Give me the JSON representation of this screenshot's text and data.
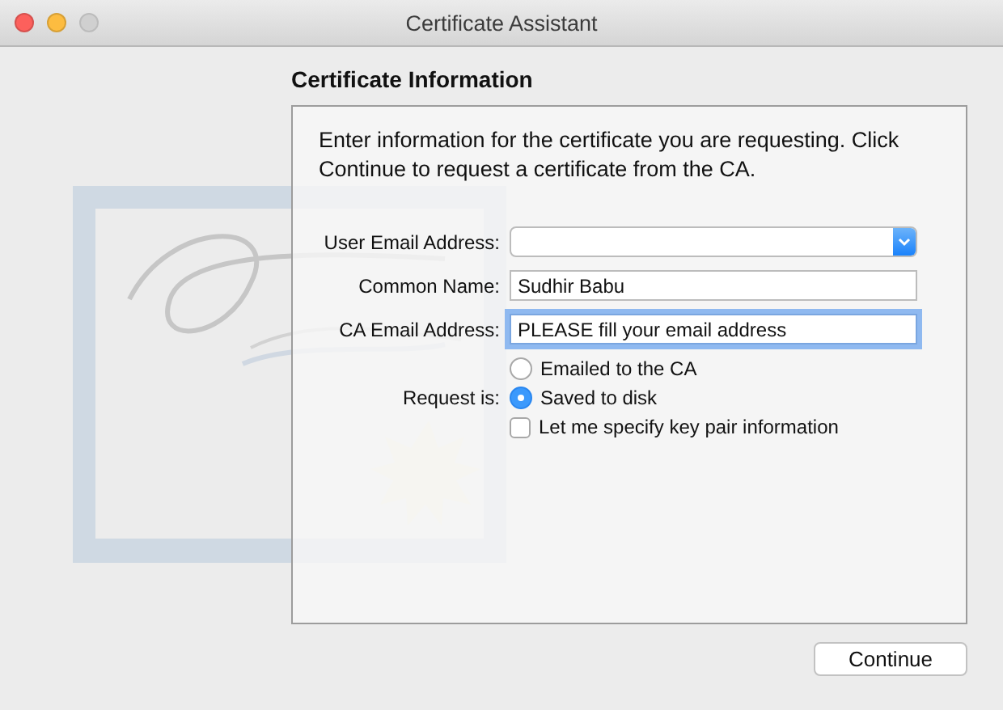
{
  "window": {
    "title": "Certificate Assistant",
    "buttons": [
      {
        "kind": "close",
        "disabled": false
      },
      {
        "kind": "minimize",
        "disabled": false
      },
      {
        "kind": "zoom",
        "disabled": true
      }
    ]
  },
  "heading": "Certificate Information",
  "description": "Enter information for the certificate you are requesting. Click Continue to request a certificate from the CA.",
  "fields": [
    {
      "label": "User Email Address:",
      "kind": "popup",
      "focused": false
    },
    {
      "label": "Common Name:",
      "kind": "text",
      "value": "Sudhir Babu",
      "focused": false
    },
    {
      "label": "CA Email Address:",
      "kind": "text",
      "value": "PLEASE fill your email address",
      "focused": true
    }
  ],
  "request": {
    "label": "Request is:",
    "options": [
      {
        "label": "Emailed to the CA",
        "selected": false
      },
      {
        "label": "Saved to disk",
        "selected": true
      }
    ]
  },
  "checkbox": {
    "label": "Let me specify key pair information",
    "checked": false
  },
  "buttons": [
    "Continue"
  ]
}
